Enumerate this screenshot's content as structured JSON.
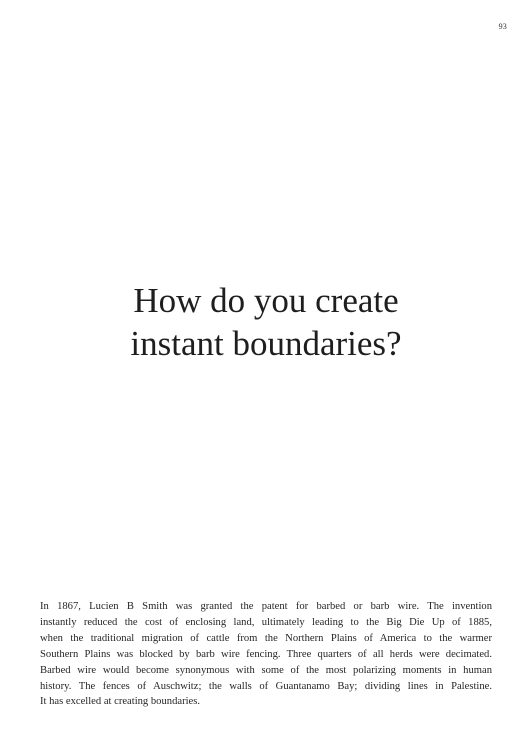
{
  "page": {
    "number": "93"
  },
  "headline": {
    "line1": "How do you create",
    "line2": "instant boundaries?"
  },
  "body": {
    "lines": [
      "In 1867, Lucien B Smith was granted the patent for barbed or barb wire. The invention",
      "instantly reduced the cost of enclosing land, ultimately leading to the Big Die Up of 1885,",
      "when the traditional migration of cattle from the Northern Plains of America to the warmer",
      "Southern Plains was blocked by barb wire fencing. Three quarters of all herds were decimated.",
      "Barbed wire would become synonymous with some of the most polarizing moments in human",
      "history. The fences of Auschwitz; the walls of Guantanamo Bay; dividing lines in Palestine.",
      "It has excelled at creating boundaries."
    ]
  }
}
